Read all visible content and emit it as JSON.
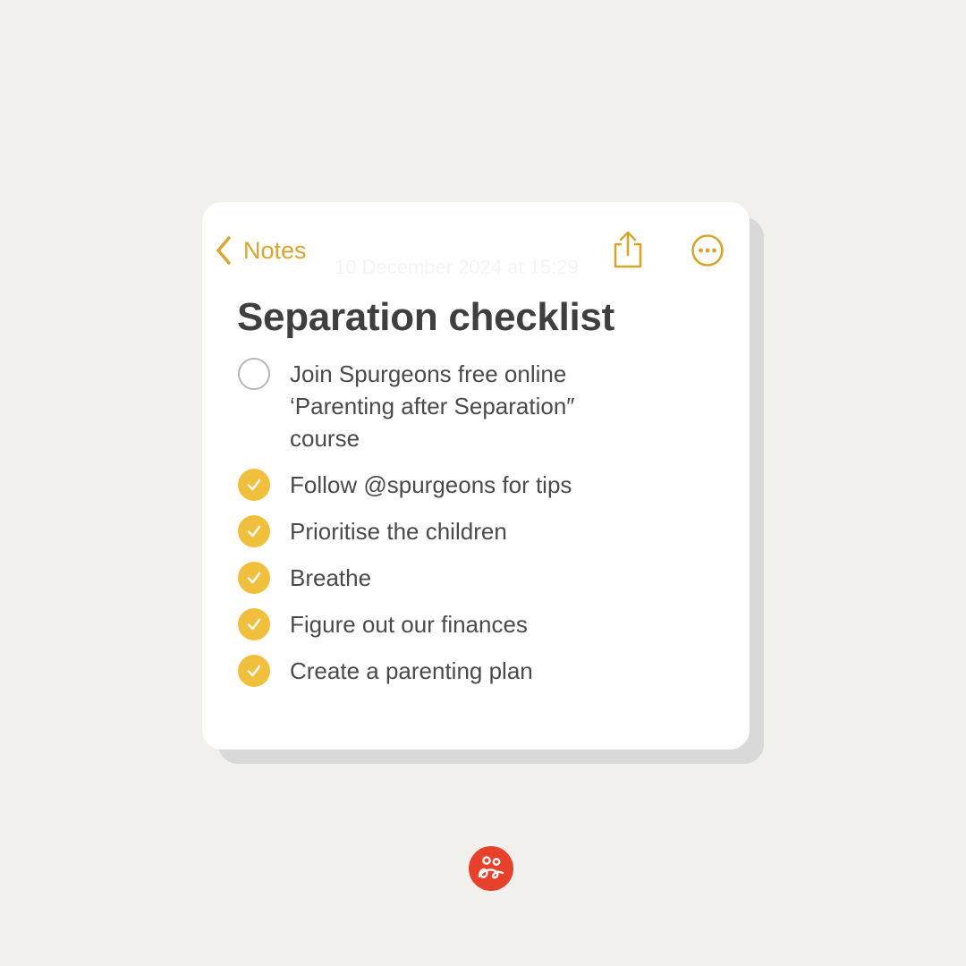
{
  "nav": {
    "back_label": "Notes",
    "share_icon": "share-icon",
    "more_icon": "more-icon"
  },
  "note": {
    "timestamp": "10 December 2024 at 15:29",
    "title": "Separation checklist",
    "items": [
      {
        "text": "Join Spurgeons free online ‘Parenting after Separation″ course",
        "checked": false
      },
      {
        "text": "Follow @spurgeons for tips",
        "checked": true
      },
      {
        "text": "Prioritise the children",
        "checked": true
      },
      {
        "text": "Breathe",
        "checked": true
      },
      {
        "text": "Figure out our finances",
        "checked": true
      },
      {
        "text": "Create a parenting plan",
        "checked": true
      }
    ]
  },
  "colors": {
    "background": "#f1f0ed",
    "card": "#ffffff",
    "accent": "#d6a62f",
    "checkbox_fill": "#f0bf3d",
    "title_text": "#3f3f3f",
    "body_text": "#4a4a4a",
    "logo": "#e8412b"
  },
  "logo": {
    "icon": "spurgeons-logo-icon"
  }
}
